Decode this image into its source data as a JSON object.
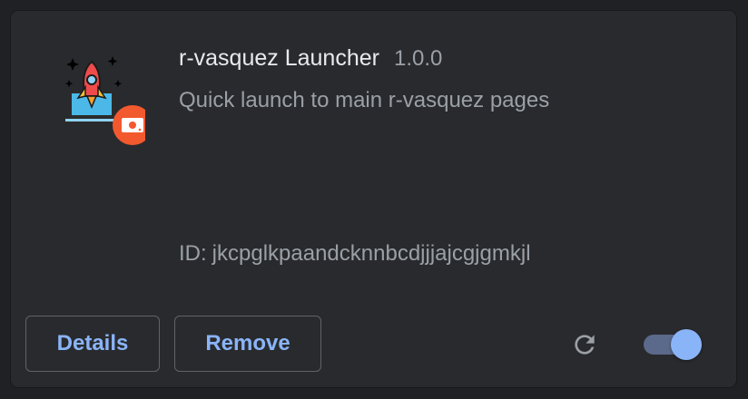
{
  "extension": {
    "name": "r-vasquez Launcher",
    "version": "1.0.0",
    "description": "Quick launch to main r-vasquez pages",
    "id_label": "ID:",
    "id_value": "jkcpglkpaandcknnbcdjjjajcgjgmkjl",
    "icon": "rocket-laptop-icon",
    "badge_icon": "hard-drive-icon"
  },
  "actions": {
    "details_label": "Details",
    "remove_label": "Remove",
    "reload_icon": "reload-icon",
    "enabled": true
  },
  "colors": {
    "background": "#202124",
    "card": "#292a2d",
    "accent": "#8ab4f8",
    "badge": "#f2592f"
  }
}
